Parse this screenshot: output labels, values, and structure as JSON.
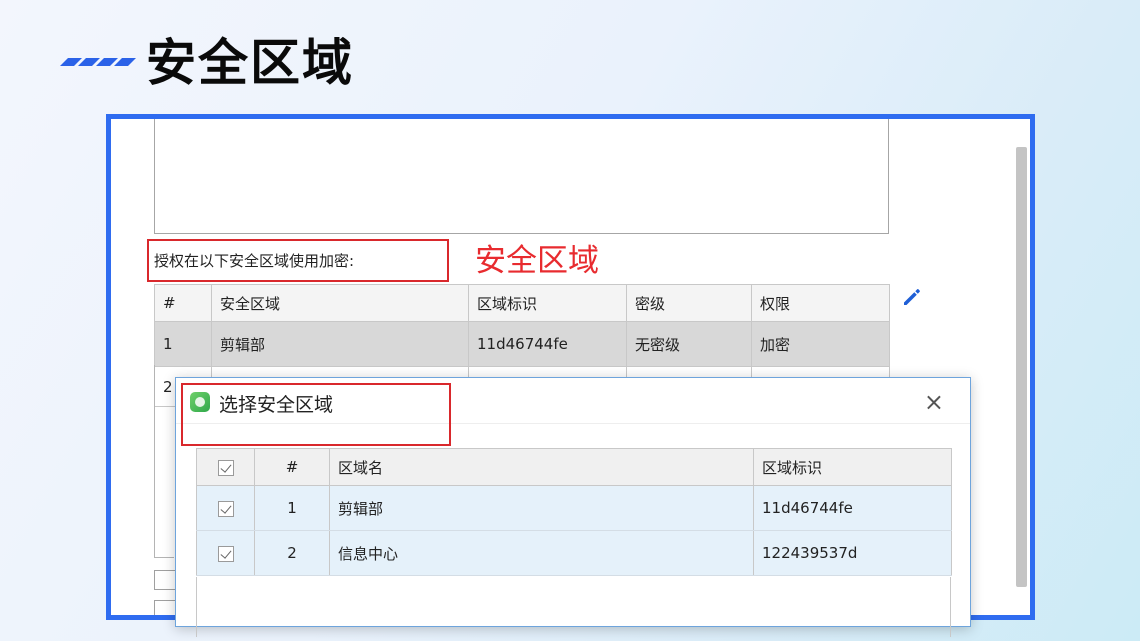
{
  "slide": {
    "title": "安全区域"
  },
  "form": {
    "auth_label": "授权在以下安全区域使用加密:",
    "annotation": "安全区域",
    "annotation_color": "#e82b2f",
    "columns": [
      "#",
      "安全区域",
      "区域标识",
      "密级",
      "权限"
    ],
    "rows": [
      {
        "num": "1",
        "zone": "剪辑部",
        "id": "11d46744fe",
        "level": "无密级",
        "perm": "加密"
      },
      {
        "num": "2",
        "zone": "",
        "id": "",
        "level": "",
        "perm": ""
      }
    ],
    "edit_icon": "pencil-icon"
  },
  "dialog": {
    "title": "选择安全区域",
    "app_icon": "app-logo-icon",
    "close_glyph": "×",
    "columns": [
      "#",
      "区域名",
      "区域标识"
    ],
    "rows": [
      {
        "num": "1",
        "name": "剪辑部",
        "id": "11d46744fe",
        "checked": true
      },
      {
        "num": "2",
        "name": "信息中心",
        "id": "122439537d",
        "checked": true
      }
    ]
  },
  "colors": {
    "accent": "#2f6cf0",
    "highlight_red": "#d9282c",
    "selected_row": "#e5f1fa"
  }
}
